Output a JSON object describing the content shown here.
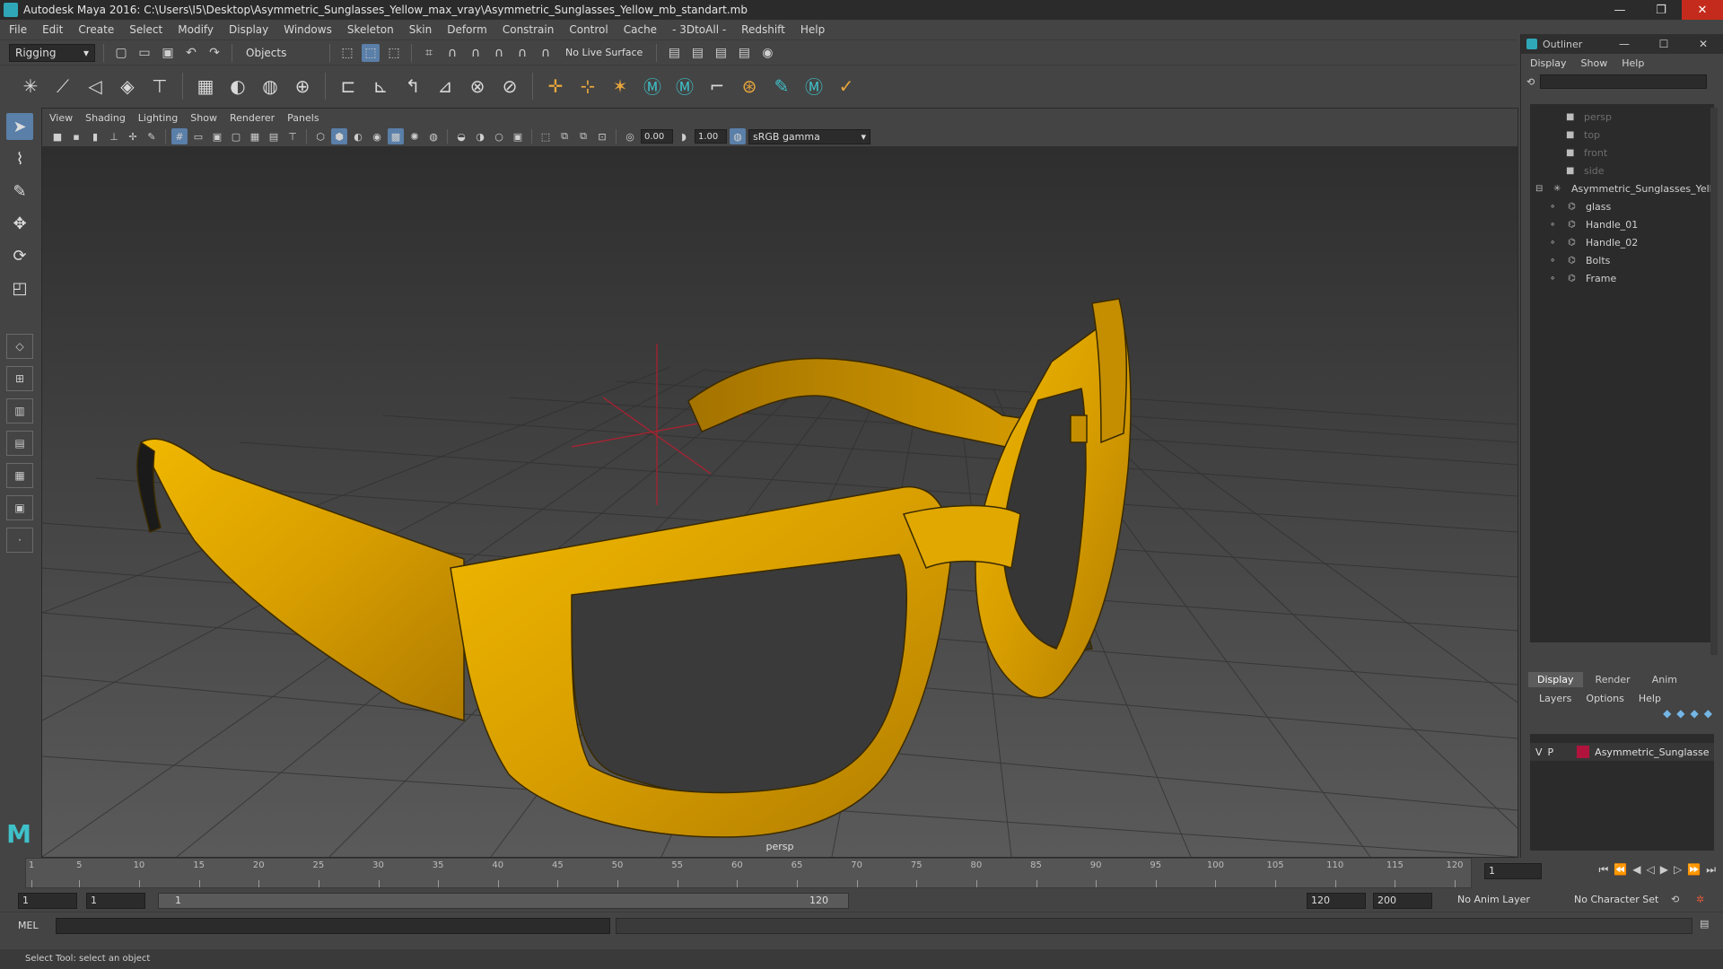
{
  "window": {
    "title": "Autodesk Maya 2016: C:\\Users\\I5\\Desktop\\Asymmetric_Sunglasses_Yellow_max_vray\\Asymmetric_Sunglasses_Yellow_mb_standart.mb",
    "minimize": "—",
    "maximize": "❐",
    "close": "✕"
  },
  "menu": [
    "File",
    "Edit",
    "Create",
    "Select",
    "Modify",
    "Display",
    "Windows",
    "Skeleton",
    "Skin",
    "Deform",
    "Constrain",
    "Control",
    "Cache",
    "- 3DtoAll -",
    "Redshift",
    "Help"
  ],
  "toolbar": {
    "mode": "Rigging",
    "select_mode": "Objects",
    "live_surface": "No Live Surface"
  },
  "viewport": {
    "menu": [
      "View",
      "Shading",
      "Lighting",
      "Show",
      "Renderer",
      "Panels"
    ],
    "field_a": "0.00",
    "field_b": "1.00",
    "gamma": "sRGB gamma",
    "camera": "persp"
  },
  "outliner": {
    "title": "Outliner",
    "menu": [
      "Display",
      "Show",
      "Help"
    ],
    "items": [
      {
        "label": "persp",
        "dim": true
      },
      {
        "label": "top",
        "dim": true
      },
      {
        "label": "front",
        "dim": true
      },
      {
        "label": "side",
        "dim": true
      },
      {
        "label": "Asymmetric_Sunglasses_Yello",
        "dim": false
      },
      {
        "label": "glass",
        "dim": false
      },
      {
        "label": "Handle_01",
        "dim": false
      },
      {
        "label": "Handle_02",
        "dim": false
      },
      {
        "label": "Bolts",
        "dim": false
      },
      {
        "label": "Frame",
        "dim": false
      }
    ]
  },
  "layers": {
    "tabs": [
      "Display",
      "Render",
      "Anim"
    ],
    "menu": [
      "Layers",
      "Options",
      "Help"
    ],
    "row": {
      "v": "V",
      "p": "P",
      "name": "Asymmetric_Sunglasse",
      "color": "#b0143c"
    }
  },
  "timeline": {
    "ticks": [
      "1",
      "5",
      "10",
      "15",
      "20",
      "25",
      "30",
      "35",
      "40",
      "45",
      "50",
      "55",
      "60",
      "65",
      "70",
      "75",
      "80",
      "85",
      "90",
      "95",
      "100",
      "105",
      "110",
      "115",
      "120"
    ],
    "current_frame": "1"
  },
  "range": {
    "start": "1",
    "playback_start": "1",
    "bar_start": "1",
    "bar_end": "120",
    "playback_end": "120",
    "end": "200",
    "anim_layer": "No Anim Layer",
    "char_set": "No Character Set"
  },
  "cmd": {
    "label": "MEL"
  },
  "help": {
    "text": "Select Tool: select an object"
  },
  "colors": {
    "frame": "#e0a800",
    "accent": "#5a7fa8"
  }
}
